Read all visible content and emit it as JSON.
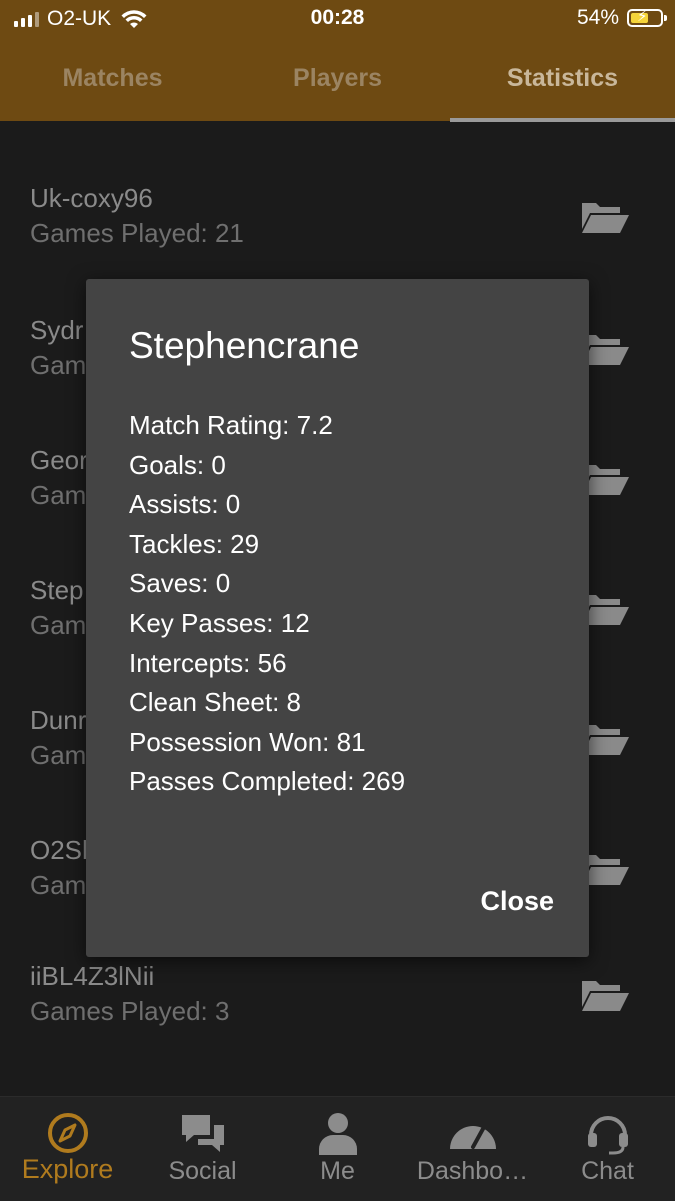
{
  "status_bar": {
    "carrier": "O2-UK",
    "time": "00:28",
    "battery": "54%"
  },
  "tabs": [
    {
      "label": "Matches"
    },
    {
      "label": "Players"
    },
    {
      "label": "Statistics"
    }
  ],
  "players": [
    {
      "name": "Uk-coxy96",
      "games": "Games Played: 21"
    },
    {
      "name": "Sydr",
      "games": "Gam"
    },
    {
      "name": "Geor",
      "games": "Gam"
    },
    {
      "name": "Step",
      "games": "Gam"
    },
    {
      "name": "Dunr",
      "games": "Gam"
    },
    {
      "name": "O2Sh",
      "games": "Gam"
    },
    {
      "name": "iiBL4Z3lNii",
      "games": "Games Played: 3"
    }
  ],
  "modal": {
    "title": "Stephencrane",
    "stats": [
      "Match Rating: 7.2",
      "Goals: 0",
      "Assists: 0",
      "Tackles: 29",
      "Saves: 0",
      "Key Passes: 12",
      "Intercepts: 56",
      "Clean Sheet: 8",
      "Possession Won: 81",
      "Passes Completed: 269"
    ],
    "close_label": "Close"
  },
  "bottom_nav": [
    {
      "label": "Explore",
      "icon": "compass-icon"
    },
    {
      "label": "Social",
      "icon": "chat-bubbles-icon"
    },
    {
      "label": "Me",
      "icon": "person-icon"
    },
    {
      "label": "Dashbo…",
      "icon": "gauge-icon"
    },
    {
      "label": "Chat",
      "icon": "headset-icon"
    }
  ],
  "colors": {
    "header": "#6e4a12",
    "accent": "#b07b1e",
    "background": "#1b1b1b",
    "modal": "#444444"
  }
}
